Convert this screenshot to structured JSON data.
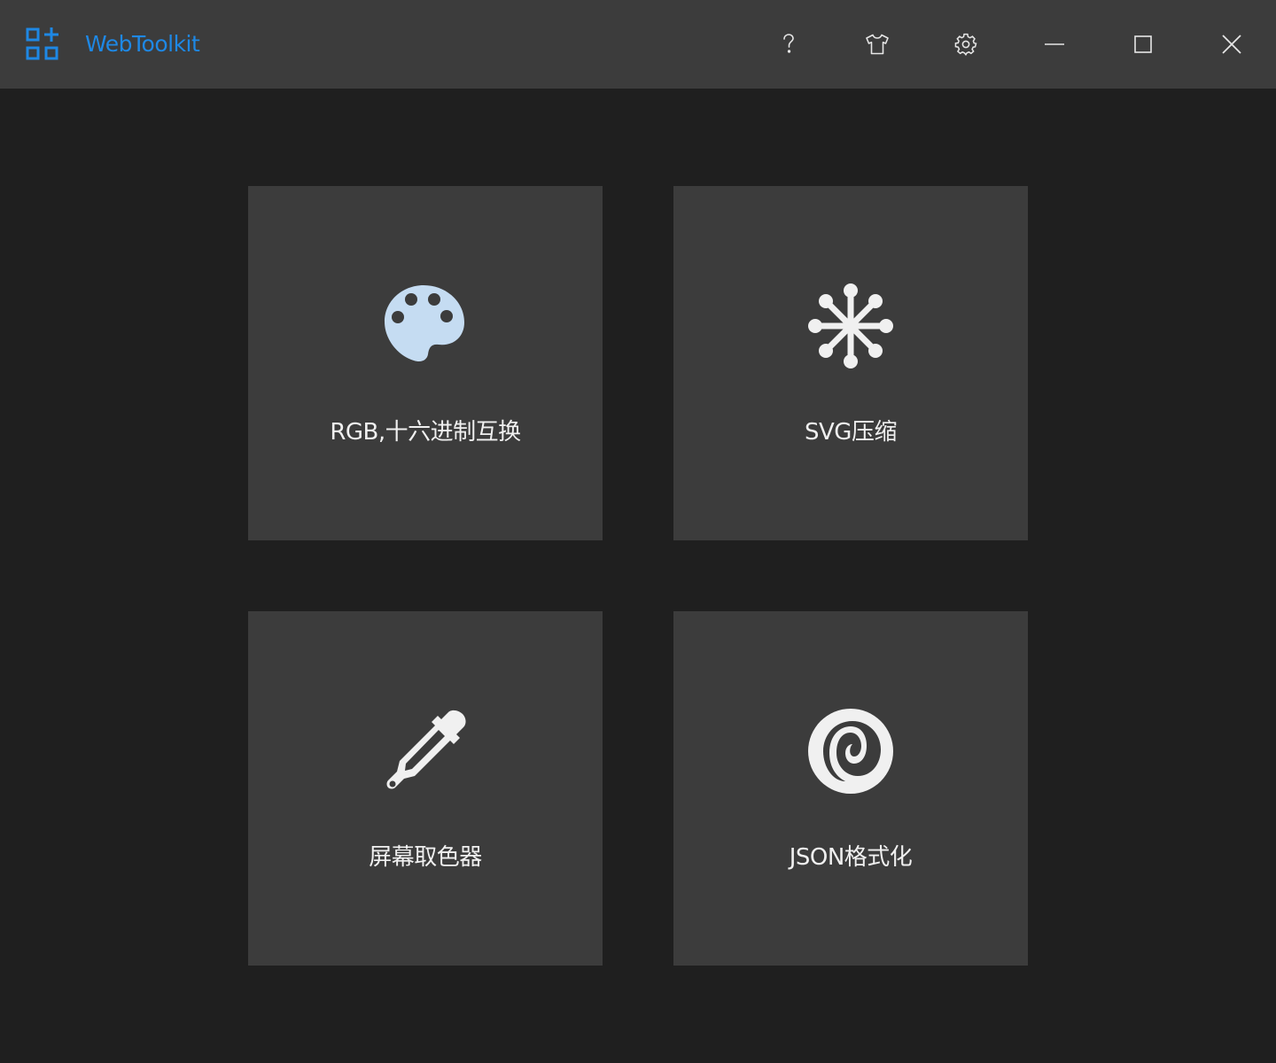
{
  "app": {
    "title": "WebToolkit"
  },
  "window_controls": [
    {
      "icon": "help-icon"
    },
    {
      "icon": "tshirt-icon"
    },
    {
      "icon": "gear-icon"
    },
    {
      "icon": "minimize-icon"
    },
    {
      "icon": "maximize-icon"
    },
    {
      "icon": "close-icon"
    }
  ],
  "tools": [
    {
      "label": "RGB,十六进制互换",
      "icon": "palette-icon"
    },
    {
      "label": "SVG压缩",
      "icon": "asterisk-icon"
    },
    {
      "label": "屏幕取色器",
      "icon": "eyedropper-icon"
    },
    {
      "label": "JSON格式化",
      "icon": "json-logo-icon"
    }
  ],
  "colors": {
    "titlebar_bg": "#3c3c3c",
    "main_bg": "#1f1f1f",
    "card_bg": "#3c3c3c",
    "accent": "#1e88e5",
    "text": "#f0f0f0",
    "palette_icon": "#c5dcf2"
  }
}
